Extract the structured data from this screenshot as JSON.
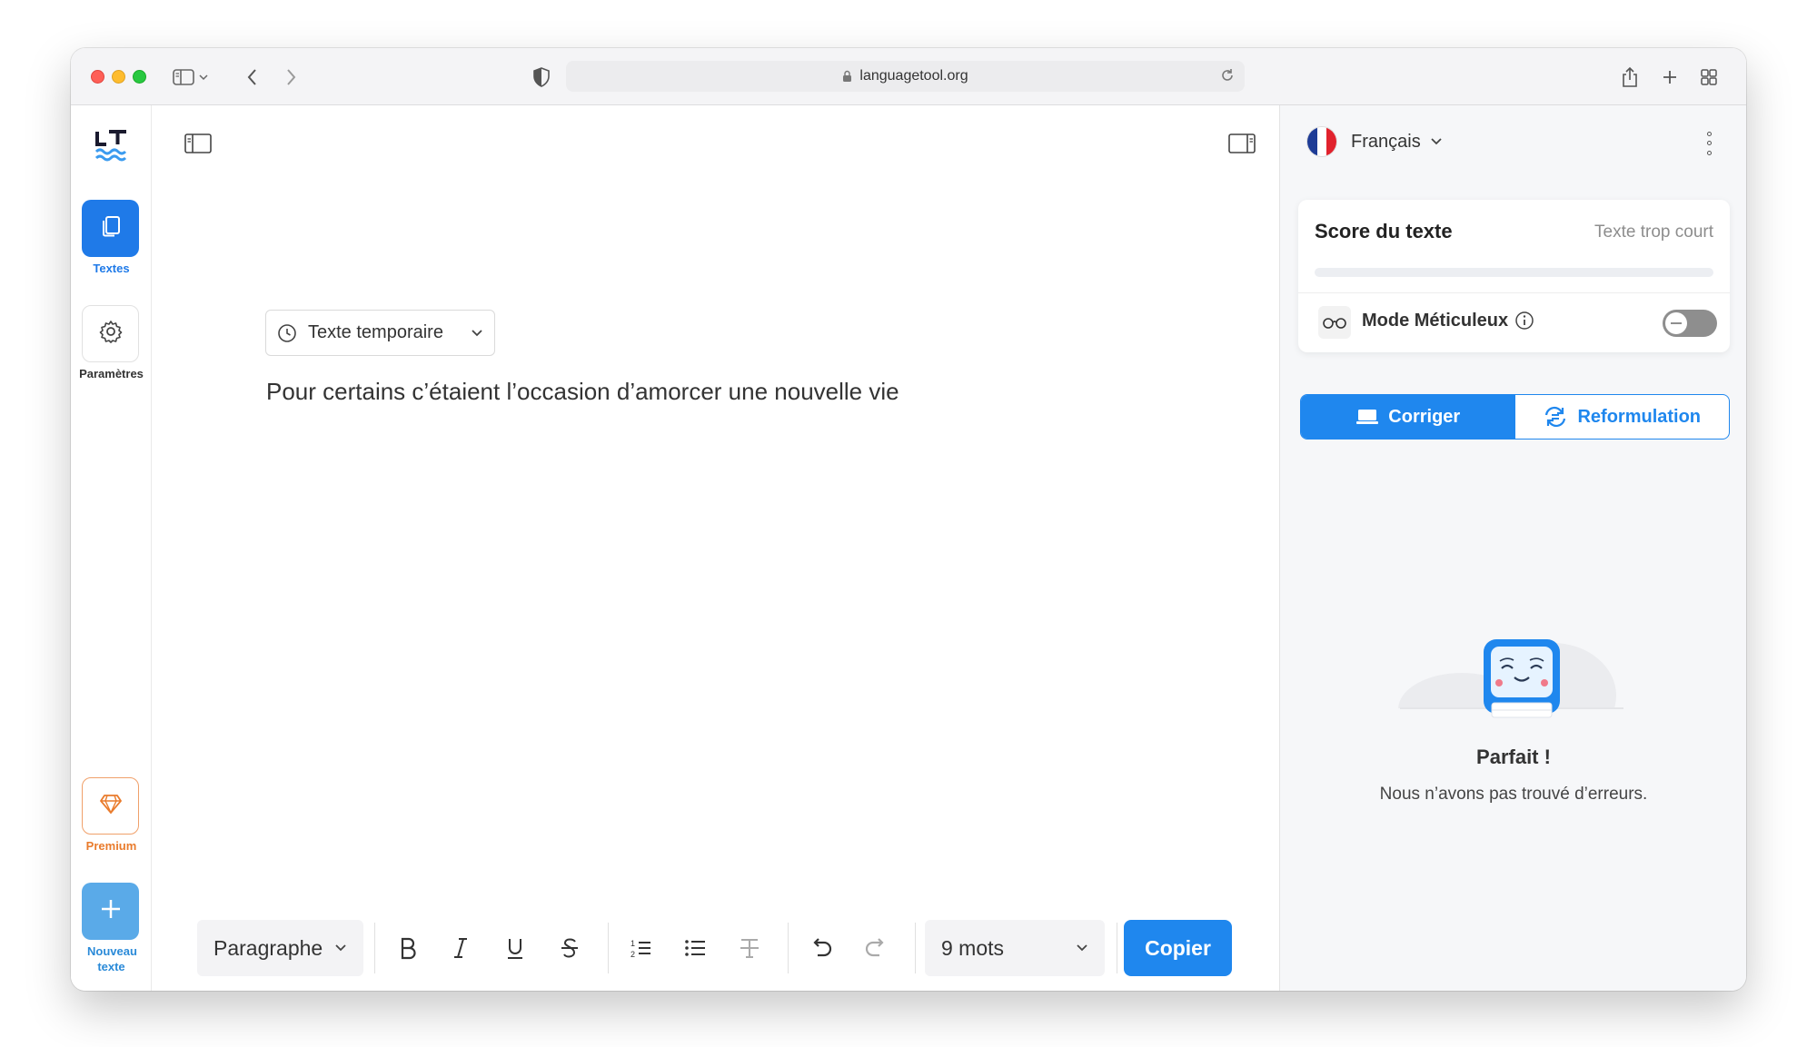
{
  "browser": {
    "url": "languagetool.org"
  },
  "nav": {
    "textes_label": "Textes",
    "params_label": "Paramètres",
    "premium_label": "Premium",
    "new_text_label": "Nouveau texte"
  },
  "editor": {
    "doc_type": "Texte temporaire",
    "content": "Pour certains c’étaient l’occasion d’amorcer une nouvelle vie"
  },
  "toolbar": {
    "paragraph_select": "Paragraphe",
    "word_count": "9 mots",
    "copy_label": "Copier"
  },
  "panel": {
    "language": "Français",
    "score_title": "Score du texte",
    "score_status": "Texte trop court",
    "score_fraction": 0,
    "mode_label": "Mode Méticuleux",
    "mode_enabled": false,
    "tabs": [
      {
        "label": "Corriger",
        "active": true
      },
      {
        "label": "Reformulation",
        "active": false
      }
    ],
    "result_title": "Parfait !",
    "result_subtitle": "Nous n’avons pas trouvé d’erreurs."
  },
  "colors": {
    "accent": "#1f87ee",
    "nav_active": "#1f7ae8",
    "premium": "#e97b2c",
    "toggle_off": "#8e8e8e"
  }
}
